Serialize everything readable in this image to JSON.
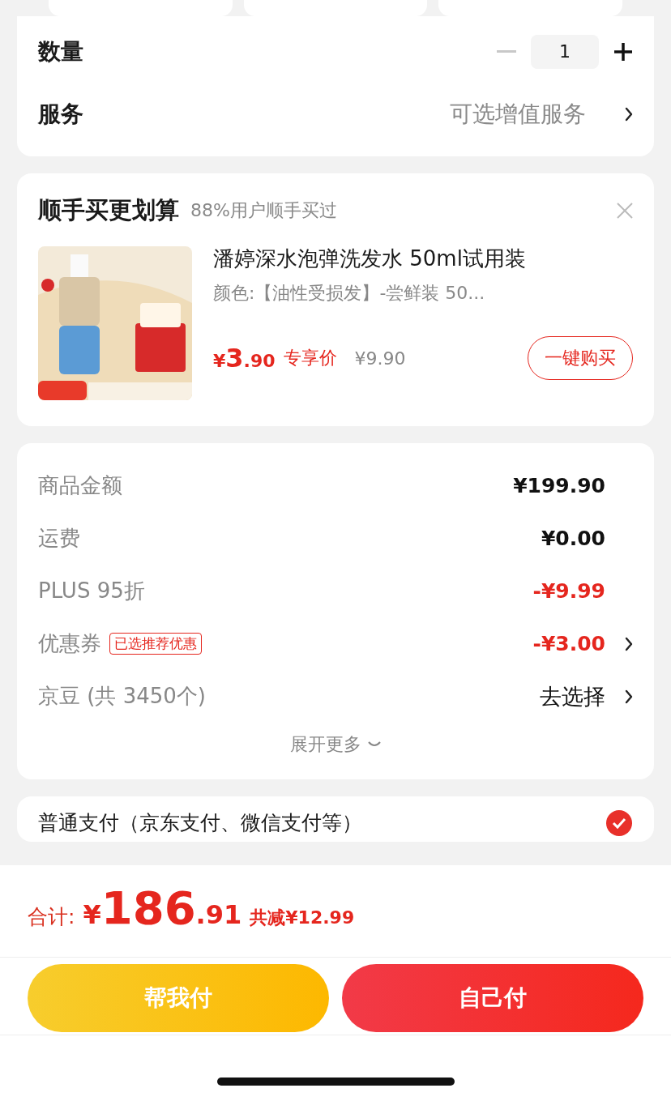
{
  "quantity_row": {
    "label": "数量",
    "value": "1",
    "minus_disabled": true
  },
  "service_row": {
    "label": "服务",
    "value": "可选增值服务"
  },
  "recommend": {
    "title": "顺手买更划算",
    "subtitle": "88%用户顺手买过",
    "product": {
      "name": "潘婷深水泡弹洗发水 50ml试用装",
      "spec": "颜色:【油性受损发】-尝鲜装 50...",
      "price_symbol": "¥",
      "price_int": "3",
      "price_dec": ".90",
      "price_label": "专享价",
      "original_price": "¥9.90",
      "buy_button": "一键购买"
    }
  },
  "summary": {
    "rows": [
      {
        "label": "商品金额",
        "value": "¥199.90",
        "discount": false,
        "chevron": false
      },
      {
        "label": "运费",
        "value": "¥0.00",
        "discount": false,
        "chevron": false
      },
      {
        "label": "PLUS 95折",
        "value": "-¥9.99",
        "discount": true,
        "chevron": false
      },
      {
        "label": "优惠券",
        "tag": "已选推荐优惠",
        "value": "-¥3.00",
        "discount": true,
        "chevron": true
      },
      {
        "label": "京豆 (共 3450个)",
        "value": "去选择",
        "discount": false,
        "chevron": true,
        "kind": "action"
      }
    ],
    "expand": "展开更多"
  },
  "payment": {
    "label": "普通支付（京东支付、微信支付等）",
    "selected": true
  },
  "footer": {
    "total_label": "合计:",
    "total_symbol": "¥",
    "total_int": "186",
    "total_dec": ".91",
    "saved": "共减¥12.99",
    "buttons": [
      {
        "label": "帮我付",
        "kind": "friend"
      },
      {
        "label": "自己付",
        "kind": "self"
      }
    ]
  }
}
